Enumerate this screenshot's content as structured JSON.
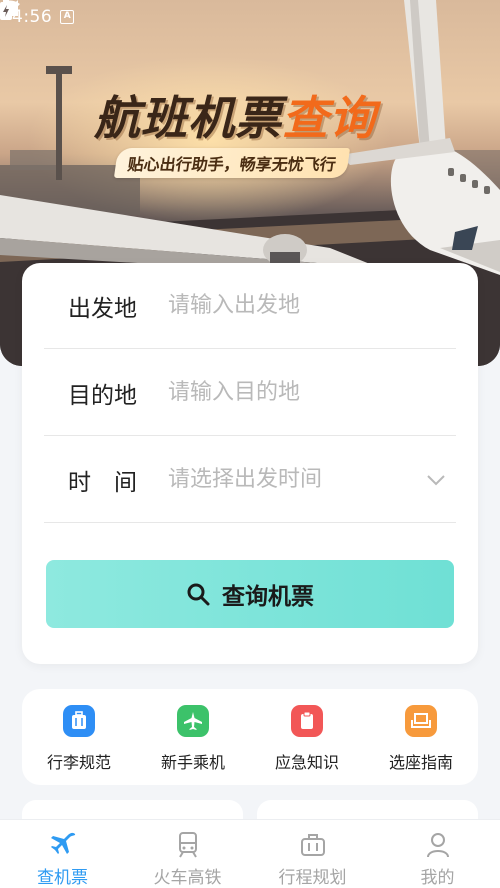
{
  "status_bar": {
    "time": "4:56",
    "notification_icon": "a-box-icon",
    "icons": [
      "wifi-icon",
      "signal-icon",
      "battery-charging-icon"
    ]
  },
  "hero": {
    "title_part1": "航班机票",
    "title_part2": "查询",
    "subtitle": "贴心出行助手，畅享无忧飞行",
    "accent_color": "#f26a1b"
  },
  "form": {
    "departure_label": "出发地",
    "departure_placeholder": "请输入出发地",
    "destination_label": "目的地",
    "destination_placeholder": "请输入目的地",
    "time_label": "时　间",
    "time_placeholder": "请选择出发时间",
    "search_button_label": "查询机票",
    "search_button_color": "#7ae3d9"
  },
  "quick_services": [
    {
      "label": "行李规范",
      "icon": "luggage-icon",
      "color": "#2e8ef5"
    },
    {
      "label": "新手乘机",
      "icon": "airplane-icon",
      "color": "#3cc26a"
    },
    {
      "label": "应急知识",
      "icon": "emergency-icon",
      "color": "#f25757"
    },
    {
      "label": "选座指南",
      "icon": "seat-icon",
      "color": "#f79a3c"
    }
  ],
  "bottom_nav": {
    "active_color": "#2f9bf2",
    "items": [
      {
        "label": "查机票",
        "icon": "airplane-icon",
        "active": true
      },
      {
        "label": "火车高铁",
        "icon": "train-icon",
        "active": false
      },
      {
        "label": "行程规划",
        "icon": "suitcase-icon",
        "active": false
      },
      {
        "label": "我的",
        "icon": "user-icon",
        "active": false
      }
    ]
  }
}
